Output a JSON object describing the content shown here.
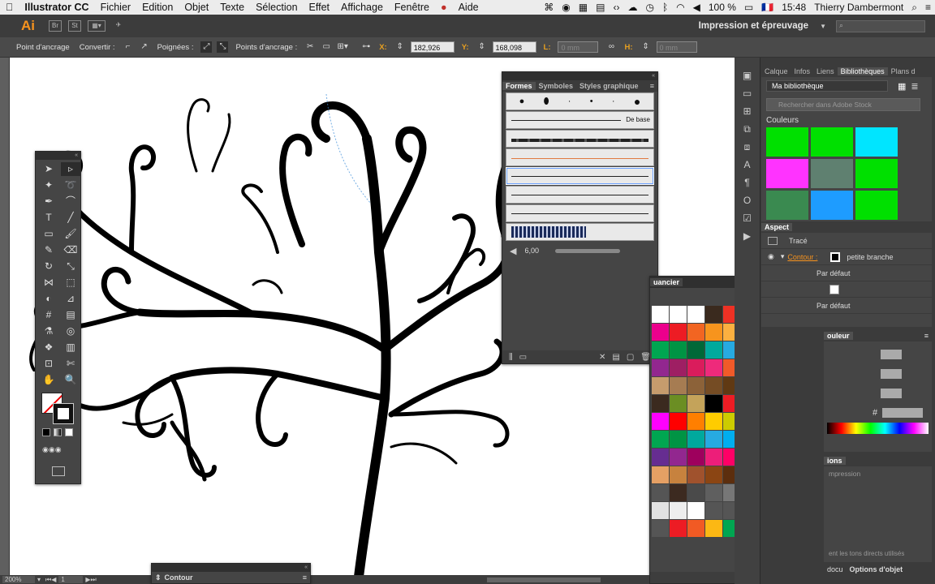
{
  "menubar": {
    "apple": "",
    "app": "Illustrator CC",
    "items": [
      "Fichier",
      "Edition",
      "Objet",
      "Texte",
      "Sélection",
      "Effet",
      "Affichage",
      "Fenêtre",
      "Aide"
    ],
    "battery": "100 %",
    "flag": "🇫🇷",
    "time": "15:48",
    "user": "Thierry Dambermont"
  },
  "appbar": {
    "logo": "Ai",
    "br": "Br",
    "st": "St",
    "workspace": "Impression et épreuvage"
  },
  "controlbar": {
    "anchor_label": "Point d'ancrage",
    "convert_label": "Convertir :",
    "handles_label": "Poignées :",
    "anchors_label": "Points d'ancrage :",
    "x_label": "X:",
    "x_value": "182,926 mm",
    "y_label": "Y:",
    "y_value": "168,098 mm",
    "l_label": "L:",
    "l_value": "0 mm",
    "h_label": "H:",
    "h_value": "0 mm"
  },
  "status": {
    "zoom": "200%",
    "page": "1"
  },
  "formes": {
    "tabs": [
      "Formes",
      "Symboles",
      "Styles graphique"
    ],
    "basic_label": "De base",
    "size_value": "6,00"
  },
  "nuancier": {
    "title": "uancier",
    "swatches": [
      "#ffffff",
      "#ffffff",
      "#ffffff",
      "#3a2a1e",
      "#ee3124",
      "#fff100",
      "#00a650",
      "#00aeef",
      "#2e3192",
      "#ec008c",
      "#ed1c24",
      "#f26522",
      "#f7941d",
      "#fbb040",
      "#fff200",
      "#d7df23",
      "#8dc63f",
      "#39b54a",
      "#00a651",
      "#009444",
      "#006838",
      "#00a99d",
      "#27aae1",
      "#1c75bc",
      "#2b3990",
      "#262262",
      "#662d91",
      "#92278f",
      "#9e1f63",
      "#da1c5c",
      "#ee2a7b",
      "#f15a29",
      "#c2b59b",
      "#998675",
      "#736357",
      "#534741",
      "#c69c6d",
      "#a67c52",
      "#8c6239",
      "#754c24",
      "#603913",
      "#d9d9d9",
      "#f7941d",
      "#1c75bc",
      "#00aeef",
      "#3b2a1f",
      "#6b8e23",
      "#c4a35a",
      "#000000",
      "#ed1c24",
      "#fff200",
      "#00a651",
      "#00ffff",
      "#0000ff",
      "#ff00ff",
      "#ff0000",
      "#ff7f00",
      "#ffcc00",
      "#cccc00",
      "#66cc33",
      "#00cc66",
      "#00cccc",
      "#3366cc",
      "#00a651",
      "#009444",
      "#00a99d",
      "#27aae1",
      "#00aeef",
      "#1c75bc",
      "#2e3192",
      "#262262",
      "#1b1464",
      "#662d91",
      "#92278f",
      "#9e005d",
      "#ed1e79",
      "#ff0066",
      "#e6a67c",
      "#b38964",
      "#8c6239",
      "#603813",
      "#e5a064",
      "#c7823e",
      "#a0522d",
      "#8b4513",
      "#5c2e0e",
      "#3b1a08",
      "#555555",
      "#555555",
      "#555555",
      "#555555",
      "#3c2a20",
      "#4a4a4a",
      "#5f5f5f",
      "#777777",
      "#8a8a8a",
      "#a3a3a3",
      "#bcbcbc",
      "#d4d4d4",
      "#e2e2e2",
      "#eeeeee",
      "#ffffff",
      "#555555",
      "#555555",
      "#555555",
      "#555555",
      "#555555",
      "#555555",
      "#555555",
      "#ed1c24",
      "#f15a24",
      "#fcb814",
      "#00a651",
      "#1c9ad6",
      "#8a4fa8",
      "#555555",
      "#555555"
    ]
  },
  "library": {
    "tabs": [
      "Calque",
      "Infos",
      "Liens",
      "Bibliothèques",
      "Plans d"
    ],
    "select": "Ma bibliothèque",
    "search_placeholder": "Rechercher dans Adobe Stock",
    "colors_title": "Couleurs",
    "colors": [
      "#00e000",
      "#00e000",
      "#00e5ff",
      "#ff33ff",
      "#5f8070",
      "#00e000",
      "#3a8a50",
      "#1e9cff",
      "#00e000"
    ]
  },
  "aspect": {
    "title": "Aspect",
    "trace": "Tracé",
    "contour_label": "Contour :",
    "contour_value": "petite branche",
    "default1": "Par défaut",
    "default2": "Par défaut"
  },
  "couleur": {
    "title": "ouleur",
    "hash": "#"
  },
  "options": {
    "title": "ions",
    "line1": "mpression",
    "footer": "ent les tons directs utilisés",
    "tabs": [
      "docu",
      "Options d'objet"
    ]
  },
  "contour_panel": {
    "title": "Contour"
  }
}
